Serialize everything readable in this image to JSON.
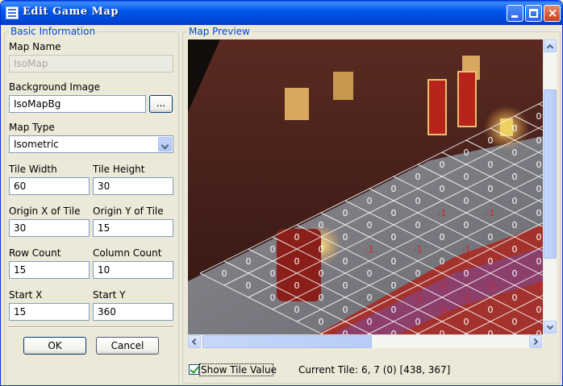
{
  "window": {
    "title": "Edit Game Map"
  },
  "basic": {
    "legend": "Basic Information",
    "map_name_label": "Map Name",
    "map_name_value": "IsoMap",
    "bg_label": "Background Image",
    "bg_value": "IsoMapBg",
    "bg_browse": "...",
    "map_type_label": "Map Type",
    "map_type_value": "Isometric",
    "tile_width_label": "Tile Width",
    "tile_width_value": "60",
    "tile_height_label": "Tile Height",
    "tile_height_value": "30",
    "origin_x_label": "Origin X of Tile",
    "origin_x_value": "30",
    "origin_y_label": "Origin Y of Tile",
    "origin_y_value": "15",
    "row_count_label": "Row Count",
    "row_count_value": "15",
    "col_count_label": "Column Count",
    "col_count_value": "10",
    "start_x_label": "Start X",
    "start_x_value": "15",
    "start_y_label": "Start Y",
    "start_y_value": "360",
    "ok": "OK",
    "cancel": "Cancel"
  },
  "preview": {
    "legend": "Map Preview",
    "show_tile_value_label": "Show Tile Value",
    "show_tile_value_checked": true,
    "current_tile_label": "Current Tile:",
    "current_tile_value": "6, 7 (0) [438, 367]",
    "tile_values_visible": [
      "0",
      "-1"
    ],
    "colors": {
      "grid": "#ffffff",
      "blocked_value": "#e02020",
      "open_value": "#ffffff"
    }
  },
  "icons": [
    "app-icon",
    "minimize-icon",
    "maximize-icon",
    "close-icon",
    "chevron-down-icon",
    "checkmark-icon"
  ]
}
